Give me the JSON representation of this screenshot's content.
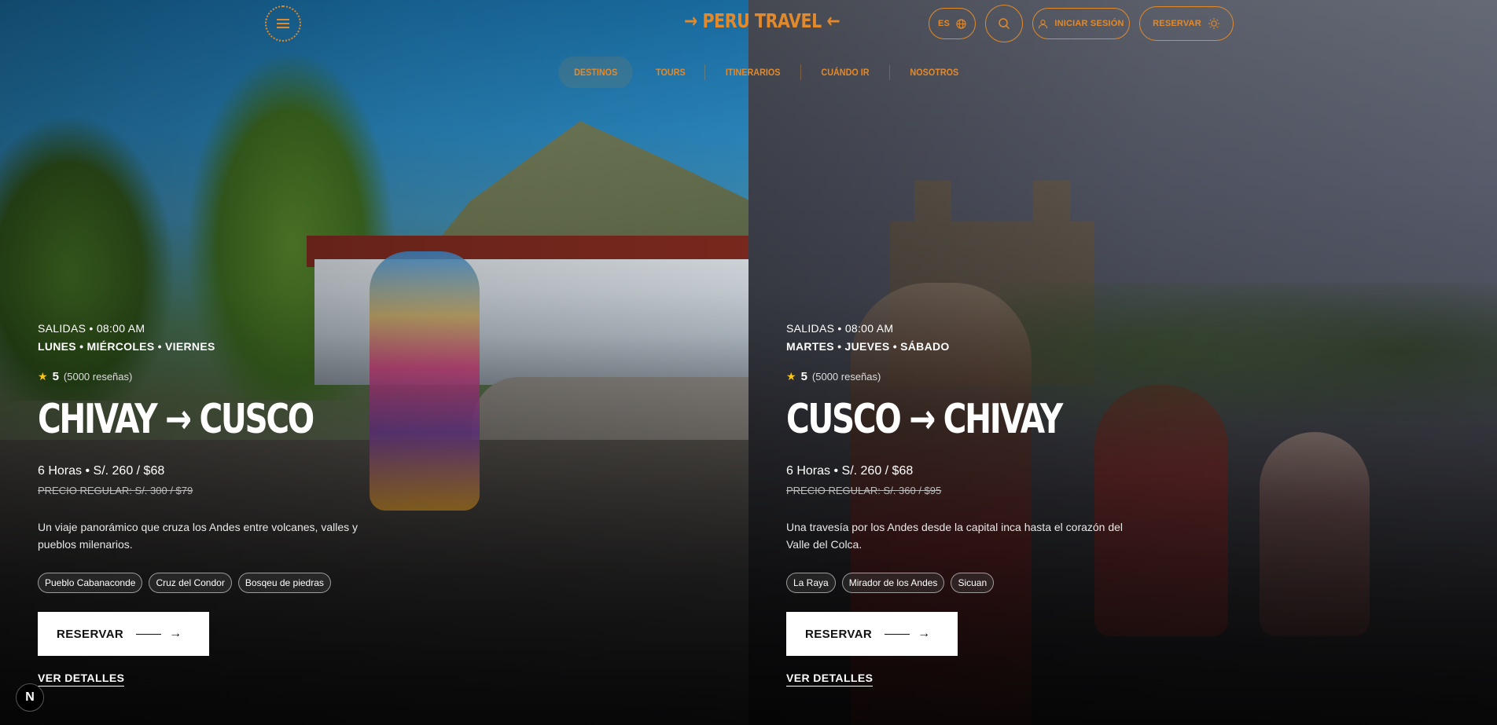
{
  "header": {
    "logo": "→ PERU TRAVEL ←",
    "lang_label": "ES",
    "login_label": "INICIAR SESIÓN",
    "book_label": "RESERVAR"
  },
  "nav": {
    "items": [
      {
        "label": "DESTINOS",
        "active": true
      },
      {
        "label": "TOURS",
        "active": false
      },
      {
        "label": "ITINERARIOS",
        "active": false
      },
      {
        "label": "CUÁNDO IR",
        "active": false
      },
      {
        "label": "NOSOTROS",
        "active": false
      }
    ]
  },
  "tours": [
    {
      "departure": "SALIDAS • 08:00 AM",
      "days": "LUNES • MIÉRCOLES • VIERNES",
      "rating": "5",
      "reviews": "(5000 reseñas)",
      "route": "CHIVAY → CUSCO",
      "price": "6 Horas • S/. 260 / $68",
      "regular_price": "PRECIO REGULAR: S/. 300 / $79",
      "description": "Un viaje panorámico que cruza los Andes entre volcanes, valles y pueblos milenarios.",
      "tags": [
        "Pueblo Cabanaconde",
        "Cruz del Condor",
        "Bosqeu de piedras"
      ],
      "cta": "RESERVAR",
      "details": "VER DETALLES"
    },
    {
      "departure": "SALIDAS • 08:00 AM",
      "days": "MARTES • JUEVES • SÁBADO",
      "rating": "5",
      "reviews": "(5000 reseñas)",
      "route": "CUSCO → CHIVAY",
      "price": "6 Horas • S/. 260 / $68",
      "regular_price": "PRECIO REGULAR: S/. 360 / $95",
      "description": "Una travesía por los Andes desde la capital inca hasta el corazón del Valle del Colca.",
      "tags": [
        "La Raya",
        "Mirador de los Andes",
        "Sicuan"
      ],
      "cta": "RESERVAR",
      "details": "VER DETALLES"
    }
  ],
  "badge": "N",
  "colors": {
    "accent": "#e28a2b",
    "star": "#f5c518"
  }
}
